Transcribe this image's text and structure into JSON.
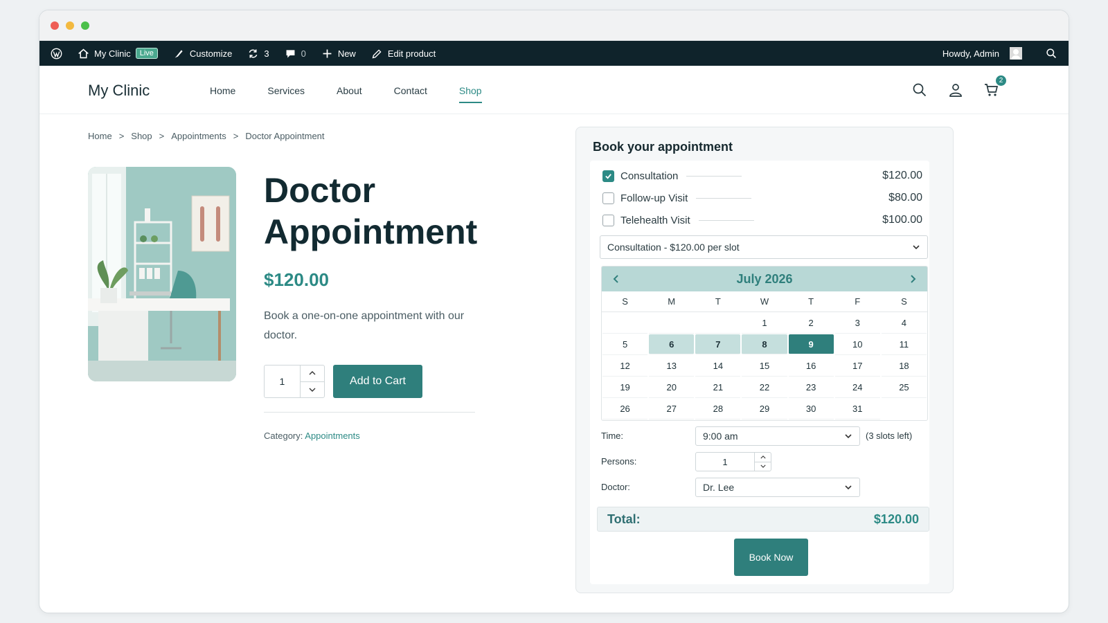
{
  "admin_bar": {
    "site_name": "My Clinic",
    "live_badge": "Live",
    "customize": "Customize",
    "updates_count": "3",
    "comments_count": "0",
    "new": "New",
    "edit_product": "Edit product",
    "howdy": "Howdy, Admin"
  },
  "site": {
    "logo": "My Clinic",
    "nav": [
      "Home",
      "Services",
      "About",
      "Contact",
      "Shop"
    ],
    "active_nav": "Shop",
    "cart_count": "2"
  },
  "breadcrumb": [
    "Home",
    ">",
    "Shop",
    ">",
    "Appointments",
    ">",
    "Doctor Appointment"
  ],
  "product": {
    "title": "Doctor Appointment",
    "price": "$120.00",
    "description": "Book a one-on-one appointment with our doctor.",
    "quantity": "1",
    "add_to_cart": "Add to Cart",
    "category_label": "Category:",
    "category": "Appointments"
  },
  "booking": {
    "title": "Book your appointment",
    "services": [
      {
        "label": "Consultation",
        "price": "$120.00",
        "checked": true
      },
      {
        "label": "Follow-up Visit",
        "price": "$80.00",
        "checked": false
      },
      {
        "label": "Telehealth Visit",
        "price": "$100.00",
        "checked": false
      }
    ],
    "service_select": "Consultation - $120.00 per slot",
    "calendar": {
      "month": "July 2026",
      "weekdays": [
        "S",
        "M",
        "T",
        "W",
        "T",
        "F",
        "S"
      ],
      "first_weekday_index": 3,
      "days_in_month": 31,
      "available_days": [
        6,
        7,
        8
      ],
      "selected_day": 9
    },
    "time_label": "Time:",
    "time_value": "9:00 am",
    "slots_left": "(3 slots left)",
    "persons_label": "Persons:",
    "persons_value": "1",
    "doctor_label": "Doctor:",
    "doctor_value": "Dr. Lee",
    "total_label": "Total:",
    "total_value": "$120.00",
    "book_now": "Book Now"
  },
  "colors": {
    "accent": "#2c8a85",
    "admin_bar": "#0f232b",
    "calendar_header": "#b8d8d6"
  }
}
